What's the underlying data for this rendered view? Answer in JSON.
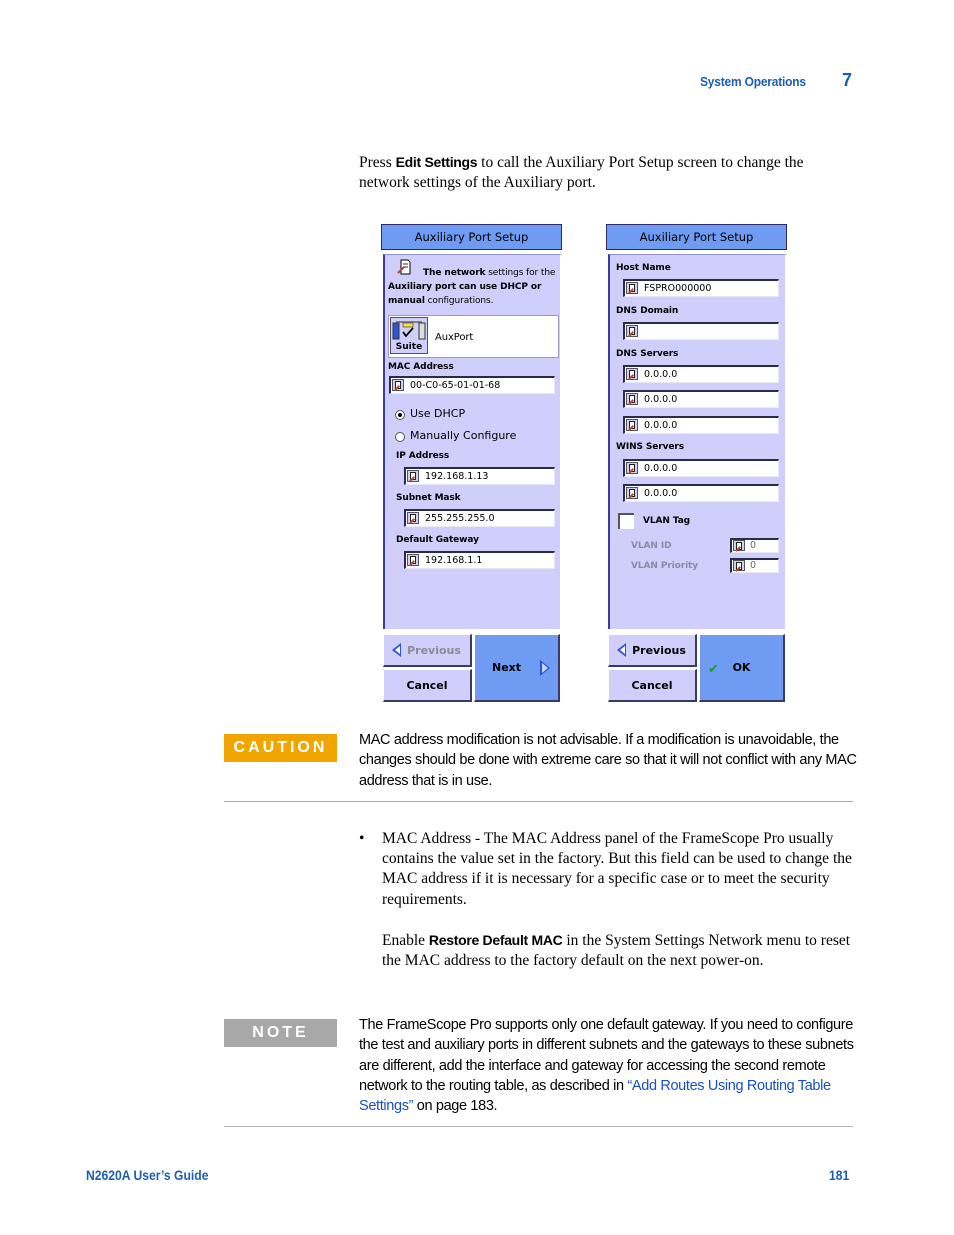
{
  "header": {
    "section_title": "System Operations",
    "chapter_number": "7"
  },
  "intro": {
    "prefix": "Press ",
    "bold": "Edit Settings",
    "suffix": " to call the Auxiliary Port Setup screen to change the network settings of the Auxiliary port."
  },
  "screen1": {
    "title": "Auxiliary Port Setup",
    "info_text_parts": [
      "The ",
      "network",
      " settings for the ",
      "Auxiliary port can use DHCP or",
      " ",
      "manual",
      " configurations."
    ],
    "suite_button_label": "Suite",
    "port_name": "AuxPort",
    "mac_label": "MAC Address",
    "mac_value": "00-C0-65-01-01-68",
    "radio_dhcp_label": "Use DHCP",
    "radio_dhcp_selected": true,
    "radio_manual_label": "Manually Configure",
    "radio_manual_selected": false,
    "ip_label": "IP Address",
    "ip_value": "192.168.1.13",
    "subnet_label": "Subnet Mask",
    "subnet_value": "255.255.255.0",
    "gateway_label": "Default Gateway",
    "gateway_value": "192.168.1.1",
    "buttons": {
      "previous": "Previous",
      "previous_enabled": false,
      "next": "Next",
      "cancel": "Cancel"
    }
  },
  "screen2": {
    "title": "Auxiliary Port Setup",
    "host_name_label": "Host Name",
    "host_name_value": "FSPRO000000",
    "dns_domain_label": "DNS Domain",
    "dns_domain_value": "",
    "dns_servers_label": "DNS Servers",
    "dns_servers": [
      "0.0.0.0",
      "0.0.0.0",
      "0.0.0.0"
    ],
    "wins_servers_label": "WINS Servers",
    "wins_servers": [
      "0.0.0.0",
      "0.0.0.0"
    ],
    "vlan_tag_label": "VLAN Tag",
    "vlan_tag_checked": false,
    "vlan_id_label": "VLAN ID",
    "vlan_id_value": "0",
    "vlan_priority_label": "VLAN Priority",
    "vlan_priority_value": "0",
    "buttons": {
      "previous": "Previous",
      "ok": "OK",
      "cancel": "Cancel"
    }
  },
  "caution": {
    "badge": "CAUTION",
    "text": "MAC address modification is not advisable. If a modification is unavoidable, the changes should be done with extreme care so that it will not conflict with any MAC address that is in use."
  },
  "bullet": {
    "symbol": "•",
    "text": "MAC Address - The MAC Address panel of the FrameScope Pro usually contains the value set in the factory. But this field can be used to change the MAC address if it is necessary for a specific case or to meet the security requirements.",
    "enable_prefix": "Enable ",
    "enable_bold": "Restore Default MAC",
    "enable_suffix": " in the System Settings Network menu to reset the MAC address to the factory default on the next power-on."
  },
  "note": {
    "badge": "NOTE",
    "text_before_link": "The FrameScope Pro supports only one default gateway. If you need to configure the test and auxiliary ports in different subnets and the gateways to these subnets are different, add the interface and gateway for accessing the second remote network to the routing table, as described in ",
    "link_text": "“Add Routes Using Routing Table Settings”",
    "text_after_link": " on page 183."
  },
  "footer": {
    "guide_title": "N2620A User’s Guide",
    "page_number": "181"
  },
  "colors": {
    "brand_blue": "#1a5fb4",
    "caution": "#f0a500",
    "note": "#a8a8a8",
    "screen_bg": "#d0cffb",
    "screen_accent": "#6f9bf2"
  }
}
